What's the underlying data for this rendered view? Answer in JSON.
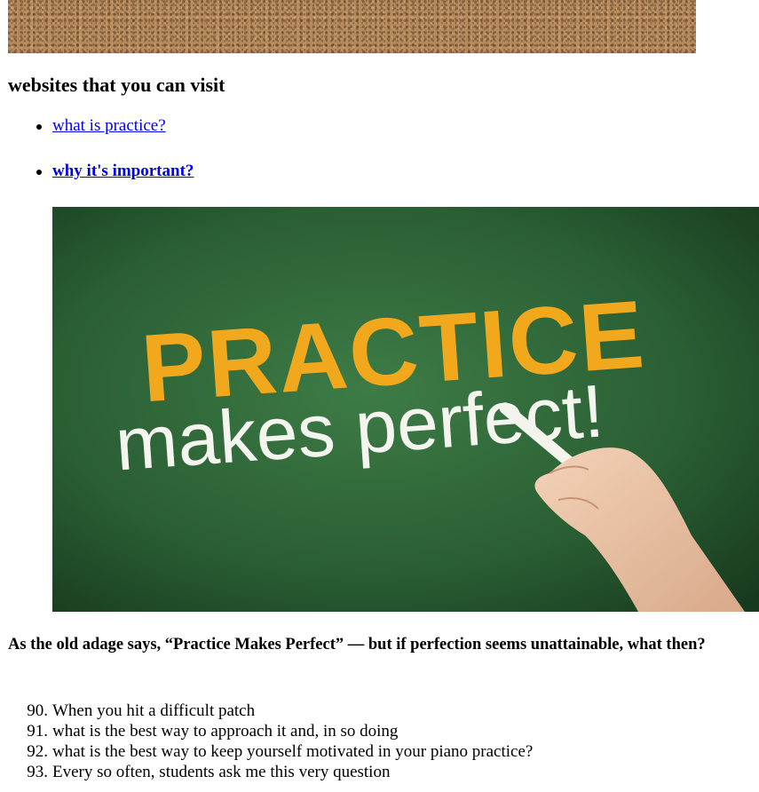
{
  "banner": {
    "texture": "cork-board",
    "color": "#b58a5d"
  },
  "sites_heading": "websites that you can visit",
  "links": [
    {
      "label": "what is practice?",
      "bold": false
    },
    {
      "label": "why it's important?",
      "bold": true
    }
  ],
  "chalkboard_image": {
    "line1": "PRACTICE",
    "line2": "makes perfect!",
    "board_color": "#2f6a3a",
    "line1_color": "#f2a81d",
    "line2_color": "#f5f5f0"
  },
  "adage": "As the old adage says, “Practice Makes Perfect” — but if perfection seems unattainable, what then?",
  "tips": [
    {
      "number": "90.",
      "text": "When you hit a difficult patch"
    },
    {
      "number": "91.",
      "text": "what is the best way to approach it and, in so doing"
    },
    {
      "number": "92.",
      "text": "what is the best way to keep yourself motivated in your piano practice?"
    },
    {
      "number": "93.",
      "text": "Every so often, students ask me this very question"
    }
  ],
  "colors": {
    "link": "#0000ee",
    "text": "#000000"
  }
}
